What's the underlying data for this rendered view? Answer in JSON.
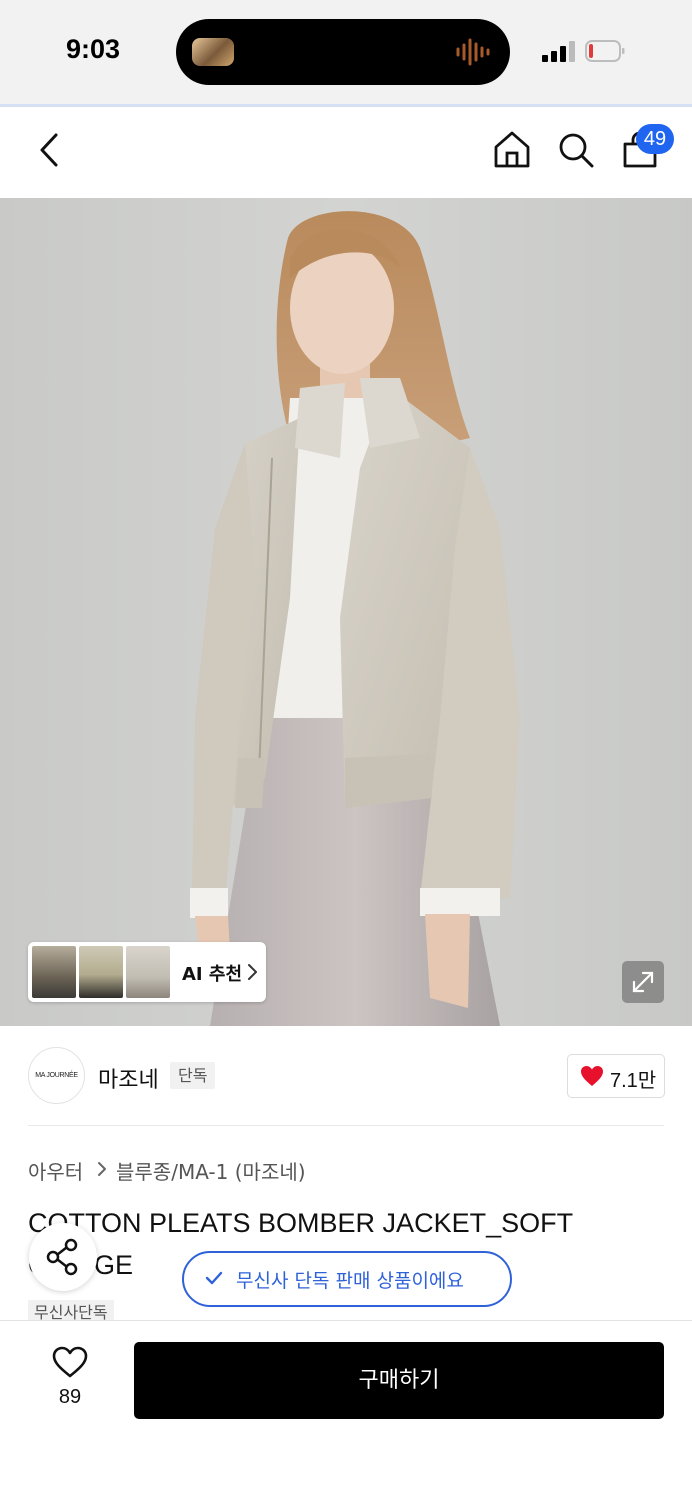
{
  "status_bar": {
    "time": "9:03",
    "signal_icon": "cellular-signal-icon",
    "battery_icon": "battery-low-icon"
  },
  "nav": {
    "back_icon": "chevron-left-icon",
    "home_icon": "home-icon",
    "search_icon": "search-icon",
    "cart_icon": "shopping-bag-icon",
    "cart_count": "49"
  },
  "product_image": {
    "ai_recommend_label": "AI 추천",
    "expand_icon": "expand-icon"
  },
  "brand": {
    "logo_text": "MA JOURNÉE",
    "name": "마조네",
    "exclusive_tag": "단독",
    "like_count": "7.1만"
  },
  "breadcrumb": {
    "category": "아우터",
    "subcategory": "블루종/MA-1 (마조네)"
  },
  "product": {
    "title": "COTTON PLEATS BOMBER JACKET_SOFT GREIGE",
    "tag": "무신사단독"
  },
  "notice": {
    "text": "무신사 단독 판매 상품이에요"
  },
  "bottom_bar": {
    "wish_count": "89",
    "buy_label": "구매하기"
  },
  "colors": {
    "accent_blue": "#1f65f0",
    "notice_blue": "#2f62d9",
    "heart_red": "#e8112d",
    "buy_button": "#000000"
  }
}
